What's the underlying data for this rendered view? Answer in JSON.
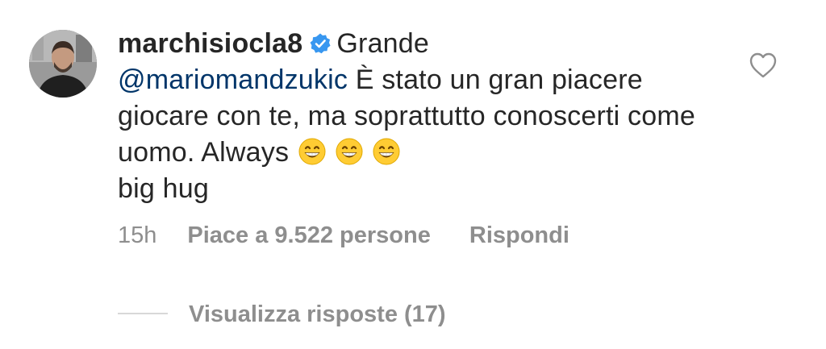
{
  "comment": {
    "username": "marchisiocla8",
    "verified": true,
    "text_before_mention": "Grande",
    "mention": "@mariomandzukic",
    "text_after_mention": "È stato un gran piacere giocare con te, ma soprattutto conoscerti come uomo. Always",
    "emojis": [
      "grinning-face-with-smiling-eyes",
      "grinning-face-with-smiling-eyes",
      "grinning-face-with-smiling-eyes"
    ],
    "text_end": "big hug",
    "time": "15h",
    "likes": "Piace a 9.522 persone",
    "reply_label": "Rispondi",
    "view_replies": "Visualizza risposte (17)"
  },
  "colors": {
    "text": "#262626",
    "mention": "#003569",
    "muted": "#8e8e8e",
    "verified": "#3897f0"
  }
}
